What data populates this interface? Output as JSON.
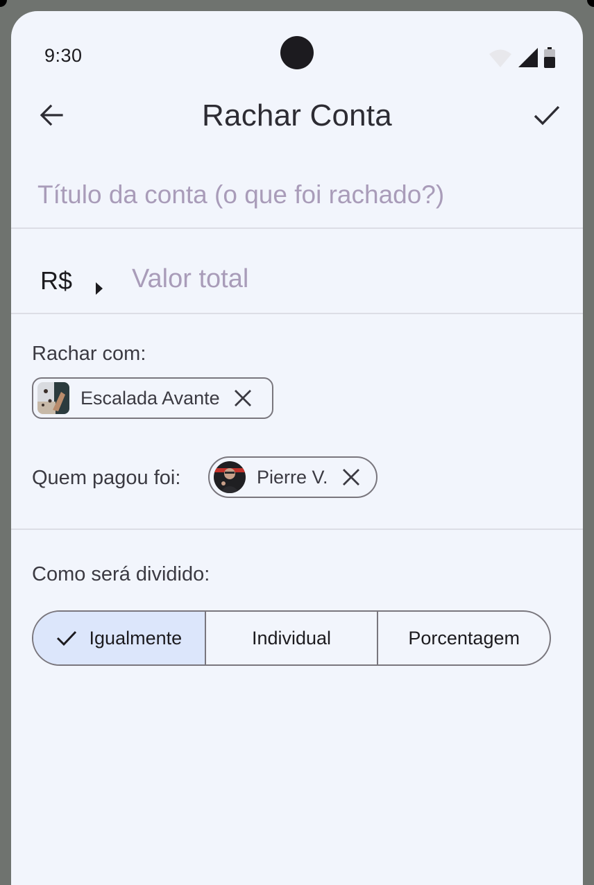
{
  "status_bar": {
    "time": "9:30"
  },
  "header": {
    "title": "Rachar Conta"
  },
  "bill_title": {
    "placeholder": "Título da conta (o que foi rachado?)"
  },
  "amount": {
    "currency": "R$",
    "placeholder": "Valor total"
  },
  "split_with": {
    "label": "Rachar com:",
    "chips": [
      {
        "label": "Escalada Avante",
        "avatar": "group-photo"
      }
    ]
  },
  "paid_by": {
    "label": "Quem pagou foi:",
    "chips": [
      {
        "label": "Pierre V.",
        "avatar": "user-photo"
      }
    ]
  },
  "split_method": {
    "label": "Como será dividido:",
    "options": [
      "Igualmente",
      "Individual",
      "Porcentagem"
    ],
    "selected": "Igualmente"
  },
  "colors": {
    "background": "#f2f5fc",
    "selected_segment": "#dce6fb",
    "placeholder": "#a99cb9",
    "outline": "#79767d"
  }
}
